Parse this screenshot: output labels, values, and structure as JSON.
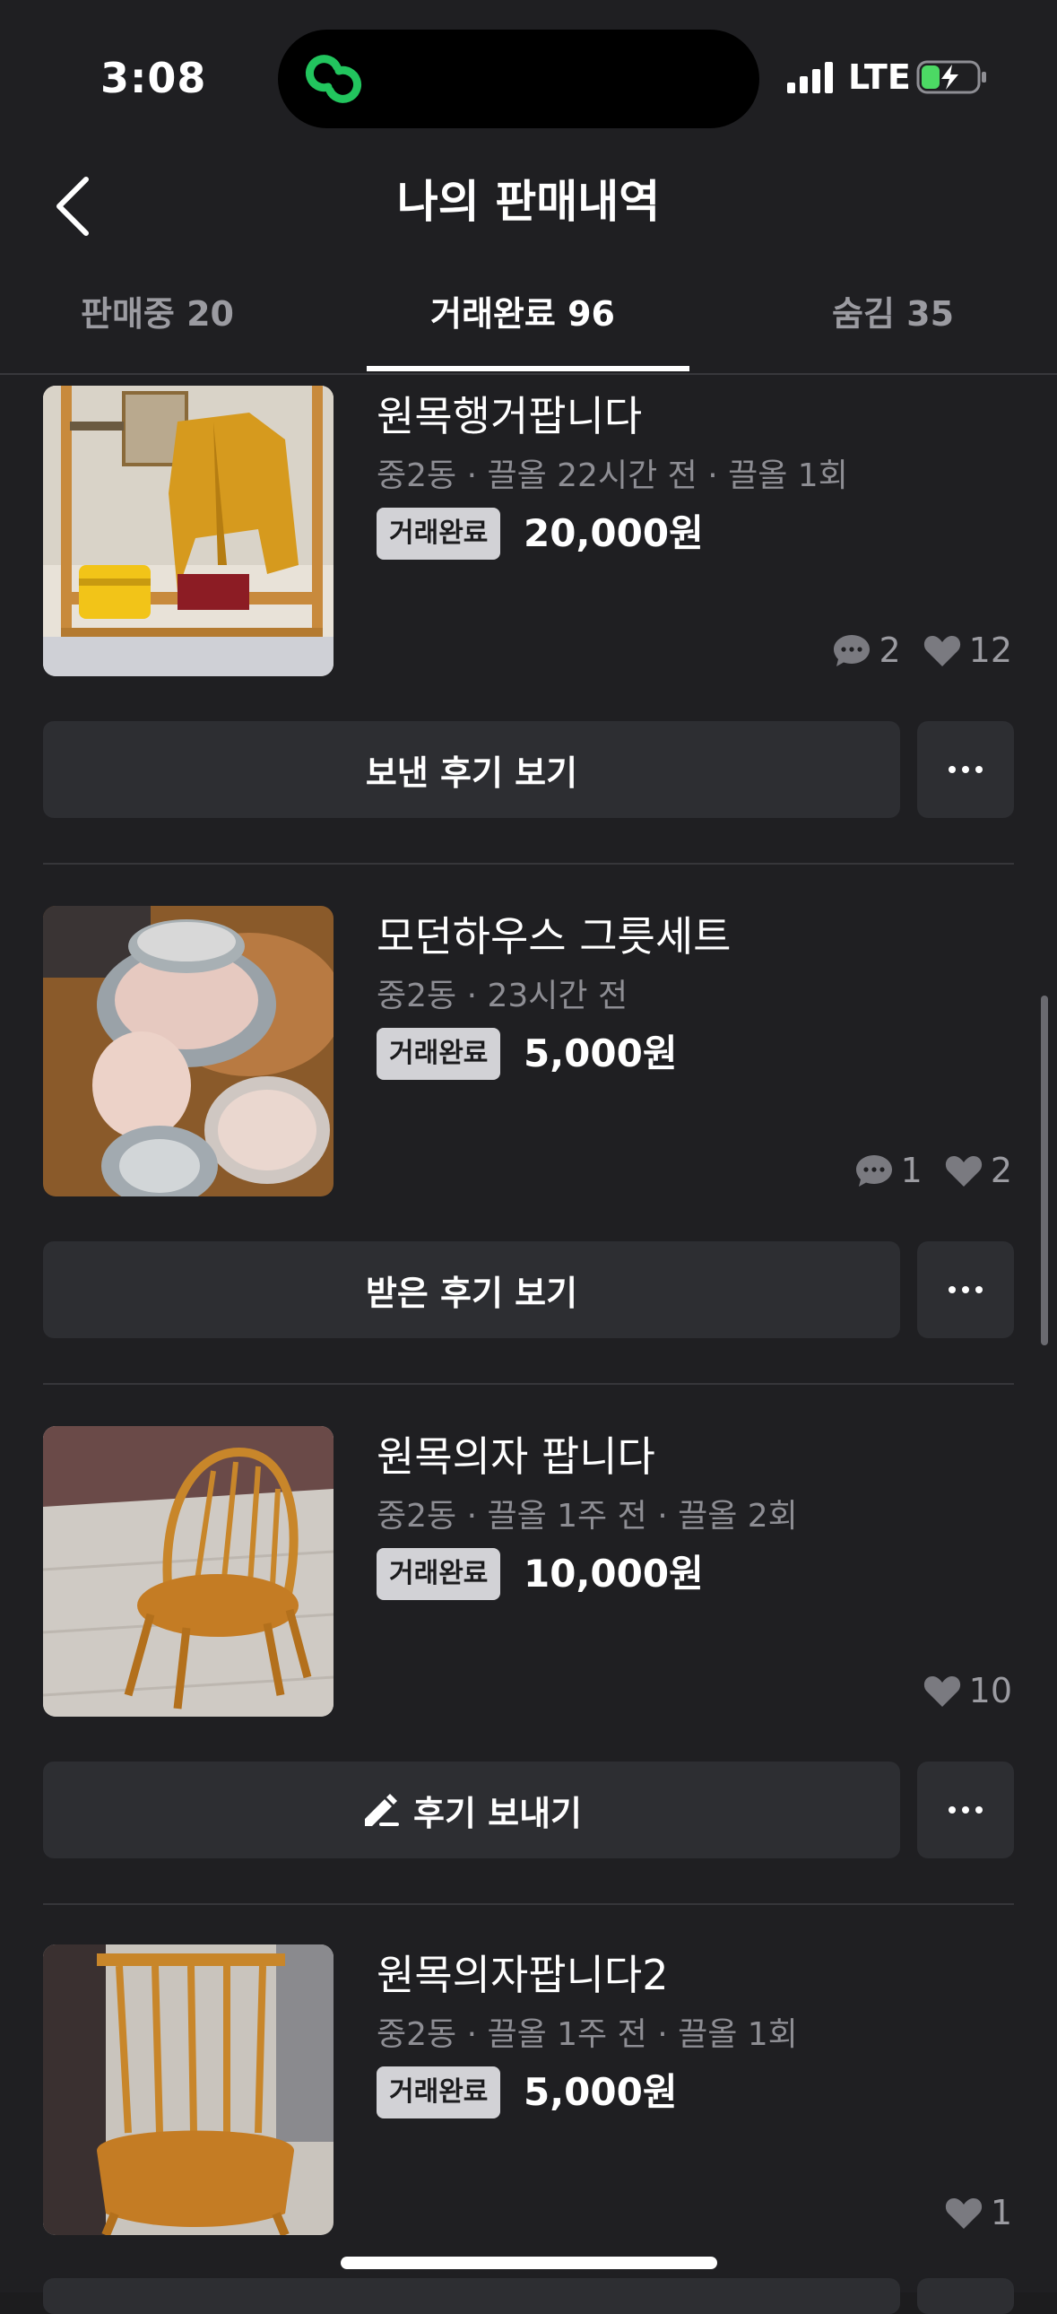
{
  "status_bar": {
    "time": "3:08",
    "network": "LTE",
    "icons": [
      "app-link-icon",
      "signal-icon",
      "battery-charging-icon"
    ]
  },
  "header": {
    "title": "나의 판매내역",
    "back_icon": "chevron-left-icon"
  },
  "tabs": [
    {
      "label": "판매중 20",
      "active": false
    },
    {
      "label": "거래완료 96",
      "active": true
    },
    {
      "label": "숨김 35",
      "active": false
    }
  ],
  "items": [
    {
      "title": "원목행거팝니다",
      "meta": "중2동 · 끌올 22시간 전 · 끌올 1회",
      "status": "거래완료",
      "price": "20,000원",
      "chats": "2",
      "likes": "12",
      "action": "보낸 후기 보기",
      "thumb": "clothes-rack-photo"
    },
    {
      "title": "모던하우스 그릇세트",
      "meta": "중2동 · 23시간 전",
      "status": "거래완료",
      "price": "5,000원",
      "chats": "1",
      "likes": "2",
      "action": "받은 후기 보기",
      "thumb": "dish-set-photo"
    },
    {
      "title": "원목의자 팝니다",
      "meta": "중2동 · 끌올 1주 전 · 끌올 2회",
      "status": "거래완료",
      "price": "10,000원",
      "chats": "",
      "likes": "10",
      "action": "후기 보내기",
      "thumb": "wooden-chair-photo"
    },
    {
      "title": "원목의자팝니다2",
      "meta": "중2동 · 끌올 1주 전 · 끌올 1회",
      "status": "거래완료",
      "price": "5,000원",
      "chats": "",
      "likes": "1",
      "action": "",
      "thumb": "wooden-chair-2-photo"
    }
  ],
  "colors": {
    "background": "#1f1f22",
    "button": "#2d2e32",
    "badge": "#d2d2d6",
    "muted_text": "#8e8e94",
    "island_icon": "#22c55e"
  }
}
